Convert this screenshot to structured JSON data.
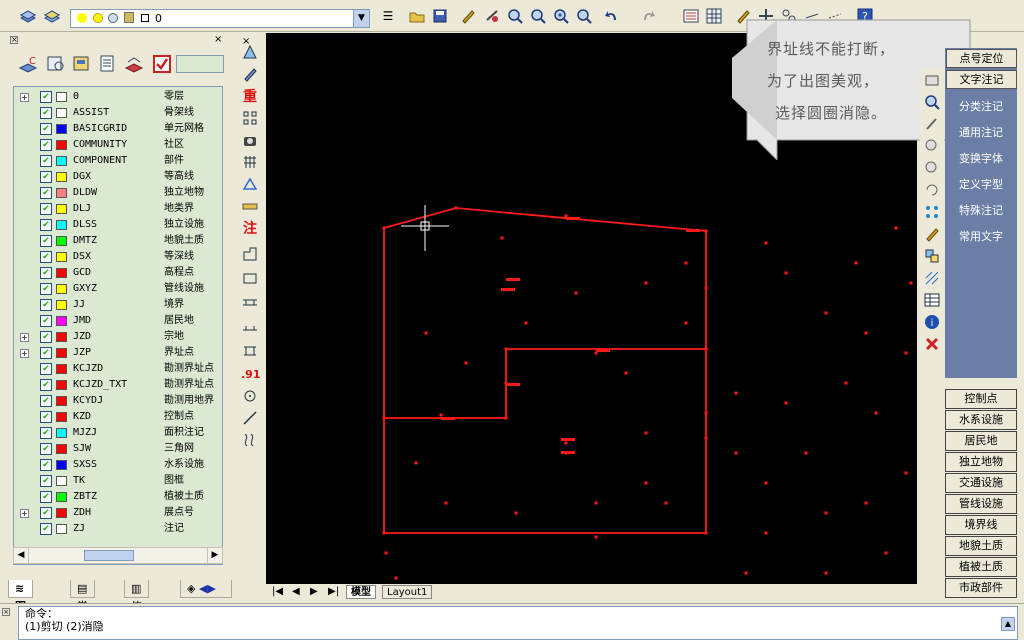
{
  "toolbar": {
    "layer_value": "0"
  },
  "palette": {
    "layers": [
      {
        "name": "0",
        "desc": "零层",
        "color": "#ffffff",
        "expand": true
      },
      {
        "name": "ASSIST",
        "desc": "骨架线",
        "color": "#ffffff",
        "expand": false
      },
      {
        "name": "BASICGRID",
        "desc": "单元网格",
        "color": "#0000ff",
        "expand": false
      },
      {
        "name": "COMMUNITY",
        "desc": "社区",
        "color": "#ff0000",
        "expand": false
      },
      {
        "name": "COMPONENT",
        "desc": "部件",
        "color": "#00ffff",
        "expand": false
      },
      {
        "name": "DGX",
        "desc": "等高线",
        "color": "#ffff00",
        "expand": false
      },
      {
        "name": "DLDW",
        "desc": "独立地物",
        "color": "#ff8080",
        "expand": false
      },
      {
        "name": "DLJ",
        "desc": "地类界",
        "color": "#ffff00",
        "expand": false
      },
      {
        "name": "DLSS",
        "desc": "独立设施",
        "color": "#00ffff",
        "expand": false
      },
      {
        "name": "DMTZ",
        "desc": "地貌土质",
        "color": "#00ff00",
        "expand": false
      },
      {
        "name": "DSX",
        "desc": "等深线",
        "color": "#ffff00",
        "expand": false
      },
      {
        "name": "GCD",
        "desc": "高程点",
        "color": "#ff0000",
        "expand": false
      },
      {
        "name": "GXYZ",
        "desc": "管线设施",
        "color": "#ffff00",
        "expand": false
      },
      {
        "name": "JJ",
        "desc": "境界",
        "color": "#ffff00",
        "expand": false
      },
      {
        "name": "JMD",
        "desc": "居民地",
        "color": "#ff00ff",
        "expand": false
      },
      {
        "name": "JZD",
        "desc": "宗地",
        "color": "#ff0000",
        "expand": true
      },
      {
        "name": "JZP",
        "desc": "界址点",
        "color": "#ff0000",
        "expand": true
      },
      {
        "name": "KCJZD",
        "desc": "勘测界址点",
        "color": "#ff0000",
        "expand": false
      },
      {
        "name": "KCJZD_TXT",
        "desc": "勘测界址点",
        "color": "#ff0000",
        "expand": false
      },
      {
        "name": "KCYDJ",
        "desc": "勘测用地界",
        "color": "#ff0000",
        "expand": false
      },
      {
        "name": "KZD",
        "desc": "控制点",
        "color": "#ff0000",
        "expand": false
      },
      {
        "name": "MJZJ",
        "desc": "面积注记",
        "color": "#00ffff",
        "expand": false
      },
      {
        "name": "SJW",
        "desc": "三角网",
        "color": "#ff0000",
        "expand": false
      },
      {
        "name": "SXSS",
        "desc": "水系设施",
        "color": "#0000ff",
        "expand": false
      },
      {
        "name": "TK",
        "desc": "图框",
        "color": "#ffffff",
        "expand": false
      },
      {
        "name": "ZBTZ",
        "desc": "植被土质",
        "color": "#00ff00",
        "expand": false
      },
      {
        "name": "ZDH",
        "desc": "展点号",
        "color": "#ff0000",
        "expand": true
      },
      {
        "name": "ZJ",
        "desc": "注记",
        "color": "#ffffff",
        "expand": false
      }
    ],
    "tabs": [
      "图层",
      "常用",
      "信息"
    ]
  },
  "callout": {
    "line1": "界址线不能打断，",
    "line2": "为了出图美观，",
    "line3": "选择圆圈消隐。"
  },
  "right_panel": {
    "top_buttons": [
      "点号定位",
      "文字注记"
    ],
    "items": [
      "分类注记",
      "通用注记",
      "变换字体",
      "定义字型",
      "特殊注记",
      "常用文字"
    ],
    "list": [
      "控制点",
      "水系设施",
      "居民地",
      "独立地物",
      "交通设施",
      "管线设施",
      "境界线",
      "地貌土质",
      "植被土质",
      "市政部件"
    ]
  },
  "vtoolbar": {
    "char1": "重",
    "char2": "注",
    "char3": ".91"
  },
  "layout_tabs": [
    "模型",
    "Layout1"
  ],
  "command": {
    "line1": "命令：",
    "line2": "(1)剪切 (2)消隐"
  },
  "drawing": {
    "boundary_color": "#ff1a1a"
  }
}
